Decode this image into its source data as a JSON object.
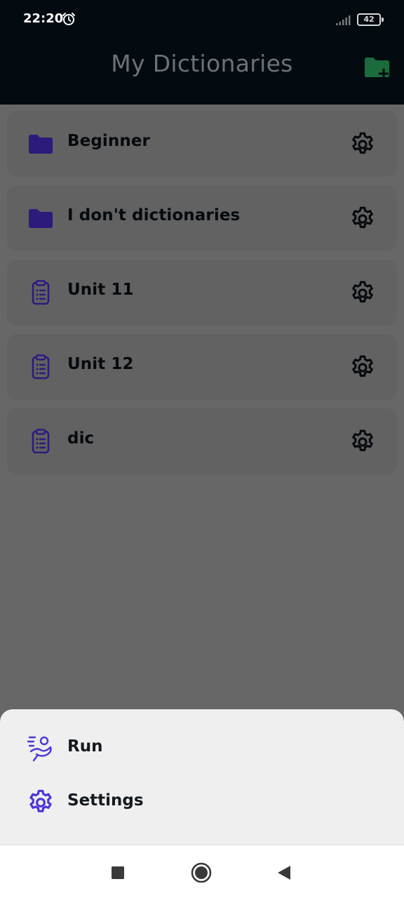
{
  "status_bar": {
    "time": "22:20",
    "battery_level": "42",
    "icons": [
      "alarm-icon",
      "signal-icon",
      "battery-icon"
    ]
  },
  "header": {
    "title": "My Dictionaries",
    "action_icon": "folder-plus-icon"
  },
  "dictionaries": [
    {
      "label": "Beginner",
      "type": "folder",
      "icon": "folder-icon"
    },
    {
      "label": "I don't dictionaries",
      "type": "folder",
      "icon": "folder-icon"
    },
    {
      "label": "Unit 11",
      "type": "dictionary",
      "icon": "clipboard-list-icon"
    },
    {
      "label": "Unit 12",
      "type": "dictionary",
      "icon": "clipboard-list-icon"
    },
    {
      "label": "dic",
      "type": "dictionary",
      "icon": "clipboard-list-icon"
    }
  ],
  "bottom_sheet": {
    "items": [
      {
        "label": "Run",
        "icon": "run-icon"
      },
      {
        "label": "Settings",
        "icon": "gear-icon"
      }
    ]
  },
  "nav_bar": {
    "buttons": [
      "recents-square-icon",
      "home-circle-icon",
      "back-triangle-icon"
    ]
  },
  "colors": {
    "header_bg": "#030b10",
    "overlay_bg": "#676767",
    "accent_purple": "#2e1a7d",
    "accent_green": "#1c6b3d",
    "sheet_bg": "#efefef",
    "sheet_icon_purple": "#4a36d9"
  }
}
